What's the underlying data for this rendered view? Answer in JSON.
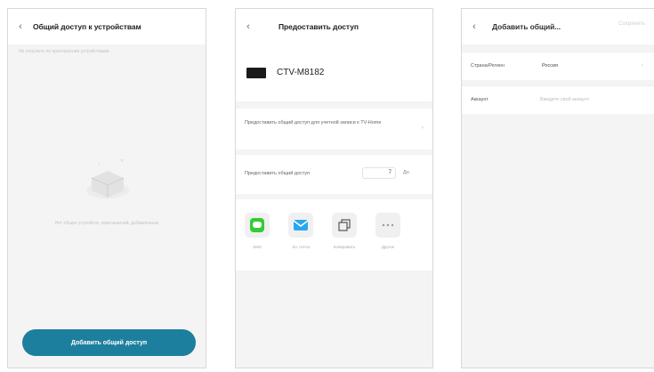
{
  "screen1": {
    "title": "Общий доступ к устройствам",
    "back_icon": "back-arrow-icon",
    "note": "Не получите ли приглашения устройствами",
    "empty_text": "Нет общих устройств, приглашений, добавленных",
    "add_button": "Добавить общий доступ"
  },
  "screen2": {
    "title": "Предоставить доступ",
    "back_icon": "back-arrow-icon",
    "device_name": "CTV-M8182",
    "share_description": "Предоставить общий доступ для учетной записи к TV-Home",
    "duration_label": "Предоставить общий доступ",
    "duration_value": "7",
    "duration_unit": "Дн",
    "apps": [
      {
        "name": "sms-icon",
        "label": "SMS",
        "color": "#33cc33"
      },
      {
        "name": "email-icon",
        "label": "Эл. почта",
        "color": "#2aa7ef"
      },
      {
        "name": "copy-icon",
        "label": "Копировать",
        "color": "#555555"
      },
      {
        "name": "more-icon",
        "label": "Другое",
        "color": "#999999"
      }
    ]
  },
  "screen3": {
    "title": "Добавить общий...",
    "save_label": "Сохранить",
    "back_icon": "back-arrow-icon",
    "rows": [
      {
        "key": "Страна/Регион",
        "value": "Россия"
      },
      {
        "key": "Аккаунт",
        "placeholder": "Введите свой аккаунт"
      }
    ]
  }
}
